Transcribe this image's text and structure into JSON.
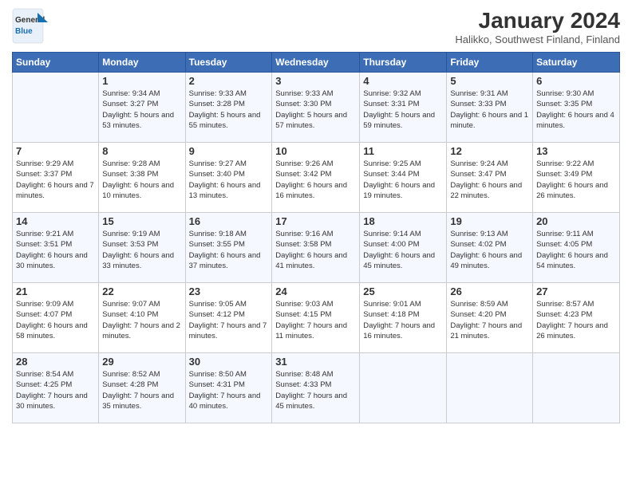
{
  "header": {
    "logo_line1": "General",
    "logo_line2": "Blue",
    "month_title": "January 2024",
    "subtitle": "Halikko, Southwest Finland, Finland"
  },
  "weekdays": [
    "Sunday",
    "Monday",
    "Tuesday",
    "Wednesday",
    "Thursday",
    "Friday",
    "Saturday"
  ],
  "weeks": [
    [
      {
        "day": "",
        "sunrise": "",
        "sunset": "",
        "daylight": ""
      },
      {
        "day": "1",
        "sunrise": "Sunrise: 9:34 AM",
        "sunset": "Sunset: 3:27 PM",
        "daylight": "Daylight: 5 hours and 53 minutes."
      },
      {
        "day": "2",
        "sunrise": "Sunrise: 9:33 AM",
        "sunset": "Sunset: 3:28 PM",
        "daylight": "Daylight: 5 hours and 55 minutes."
      },
      {
        "day": "3",
        "sunrise": "Sunrise: 9:33 AM",
        "sunset": "Sunset: 3:30 PM",
        "daylight": "Daylight: 5 hours and 57 minutes."
      },
      {
        "day": "4",
        "sunrise": "Sunrise: 9:32 AM",
        "sunset": "Sunset: 3:31 PM",
        "daylight": "Daylight: 5 hours and 59 minutes."
      },
      {
        "day": "5",
        "sunrise": "Sunrise: 9:31 AM",
        "sunset": "Sunset: 3:33 PM",
        "daylight": "Daylight: 6 hours and 1 minute."
      },
      {
        "day": "6",
        "sunrise": "Sunrise: 9:30 AM",
        "sunset": "Sunset: 3:35 PM",
        "daylight": "Daylight: 6 hours and 4 minutes."
      }
    ],
    [
      {
        "day": "7",
        "sunrise": "Sunrise: 9:29 AM",
        "sunset": "Sunset: 3:37 PM",
        "daylight": "Daylight: 6 hours and 7 minutes."
      },
      {
        "day": "8",
        "sunrise": "Sunrise: 9:28 AM",
        "sunset": "Sunset: 3:38 PM",
        "daylight": "Daylight: 6 hours and 10 minutes."
      },
      {
        "day": "9",
        "sunrise": "Sunrise: 9:27 AM",
        "sunset": "Sunset: 3:40 PM",
        "daylight": "Daylight: 6 hours and 13 minutes."
      },
      {
        "day": "10",
        "sunrise": "Sunrise: 9:26 AM",
        "sunset": "Sunset: 3:42 PM",
        "daylight": "Daylight: 6 hours and 16 minutes."
      },
      {
        "day": "11",
        "sunrise": "Sunrise: 9:25 AM",
        "sunset": "Sunset: 3:44 PM",
        "daylight": "Daylight: 6 hours and 19 minutes."
      },
      {
        "day": "12",
        "sunrise": "Sunrise: 9:24 AM",
        "sunset": "Sunset: 3:47 PM",
        "daylight": "Daylight: 6 hours and 22 minutes."
      },
      {
        "day": "13",
        "sunrise": "Sunrise: 9:22 AM",
        "sunset": "Sunset: 3:49 PM",
        "daylight": "Daylight: 6 hours and 26 minutes."
      }
    ],
    [
      {
        "day": "14",
        "sunrise": "Sunrise: 9:21 AM",
        "sunset": "Sunset: 3:51 PM",
        "daylight": "Daylight: 6 hours and 30 minutes."
      },
      {
        "day": "15",
        "sunrise": "Sunrise: 9:19 AM",
        "sunset": "Sunset: 3:53 PM",
        "daylight": "Daylight: 6 hours and 33 minutes."
      },
      {
        "day": "16",
        "sunrise": "Sunrise: 9:18 AM",
        "sunset": "Sunset: 3:55 PM",
        "daylight": "Daylight: 6 hours and 37 minutes."
      },
      {
        "day": "17",
        "sunrise": "Sunrise: 9:16 AM",
        "sunset": "Sunset: 3:58 PM",
        "daylight": "Daylight: 6 hours and 41 minutes."
      },
      {
        "day": "18",
        "sunrise": "Sunrise: 9:14 AM",
        "sunset": "Sunset: 4:00 PM",
        "daylight": "Daylight: 6 hours and 45 minutes."
      },
      {
        "day": "19",
        "sunrise": "Sunrise: 9:13 AM",
        "sunset": "Sunset: 4:02 PM",
        "daylight": "Daylight: 6 hours and 49 minutes."
      },
      {
        "day": "20",
        "sunrise": "Sunrise: 9:11 AM",
        "sunset": "Sunset: 4:05 PM",
        "daylight": "Daylight: 6 hours and 54 minutes."
      }
    ],
    [
      {
        "day": "21",
        "sunrise": "Sunrise: 9:09 AM",
        "sunset": "Sunset: 4:07 PM",
        "daylight": "Daylight: 6 hours and 58 minutes."
      },
      {
        "day": "22",
        "sunrise": "Sunrise: 9:07 AM",
        "sunset": "Sunset: 4:10 PM",
        "daylight": "Daylight: 7 hours and 2 minutes."
      },
      {
        "day": "23",
        "sunrise": "Sunrise: 9:05 AM",
        "sunset": "Sunset: 4:12 PM",
        "daylight": "Daylight: 7 hours and 7 minutes."
      },
      {
        "day": "24",
        "sunrise": "Sunrise: 9:03 AM",
        "sunset": "Sunset: 4:15 PM",
        "daylight": "Daylight: 7 hours and 11 minutes."
      },
      {
        "day": "25",
        "sunrise": "Sunrise: 9:01 AM",
        "sunset": "Sunset: 4:18 PM",
        "daylight": "Daylight: 7 hours and 16 minutes."
      },
      {
        "day": "26",
        "sunrise": "Sunrise: 8:59 AM",
        "sunset": "Sunset: 4:20 PM",
        "daylight": "Daylight: 7 hours and 21 minutes."
      },
      {
        "day": "27",
        "sunrise": "Sunrise: 8:57 AM",
        "sunset": "Sunset: 4:23 PM",
        "daylight": "Daylight: 7 hours and 26 minutes."
      }
    ],
    [
      {
        "day": "28",
        "sunrise": "Sunrise: 8:54 AM",
        "sunset": "Sunset: 4:25 PM",
        "daylight": "Daylight: 7 hours and 30 minutes."
      },
      {
        "day": "29",
        "sunrise": "Sunrise: 8:52 AM",
        "sunset": "Sunset: 4:28 PM",
        "daylight": "Daylight: 7 hours and 35 minutes."
      },
      {
        "day": "30",
        "sunrise": "Sunrise: 8:50 AM",
        "sunset": "Sunset: 4:31 PM",
        "daylight": "Daylight: 7 hours and 40 minutes."
      },
      {
        "day": "31",
        "sunrise": "Sunrise: 8:48 AM",
        "sunset": "Sunset: 4:33 PM",
        "daylight": "Daylight: 7 hours and 45 minutes."
      },
      {
        "day": "",
        "sunrise": "",
        "sunset": "",
        "daylight": ""
      },
      {
        "day": "",
        "sunrise": "",
        "sunset": "",
        "daylight": ""
      },
      {
        "day": "",
        "sunrise": "",
        "sunset": "",
        "daylight": ""
      }
    ]
  ]
}
